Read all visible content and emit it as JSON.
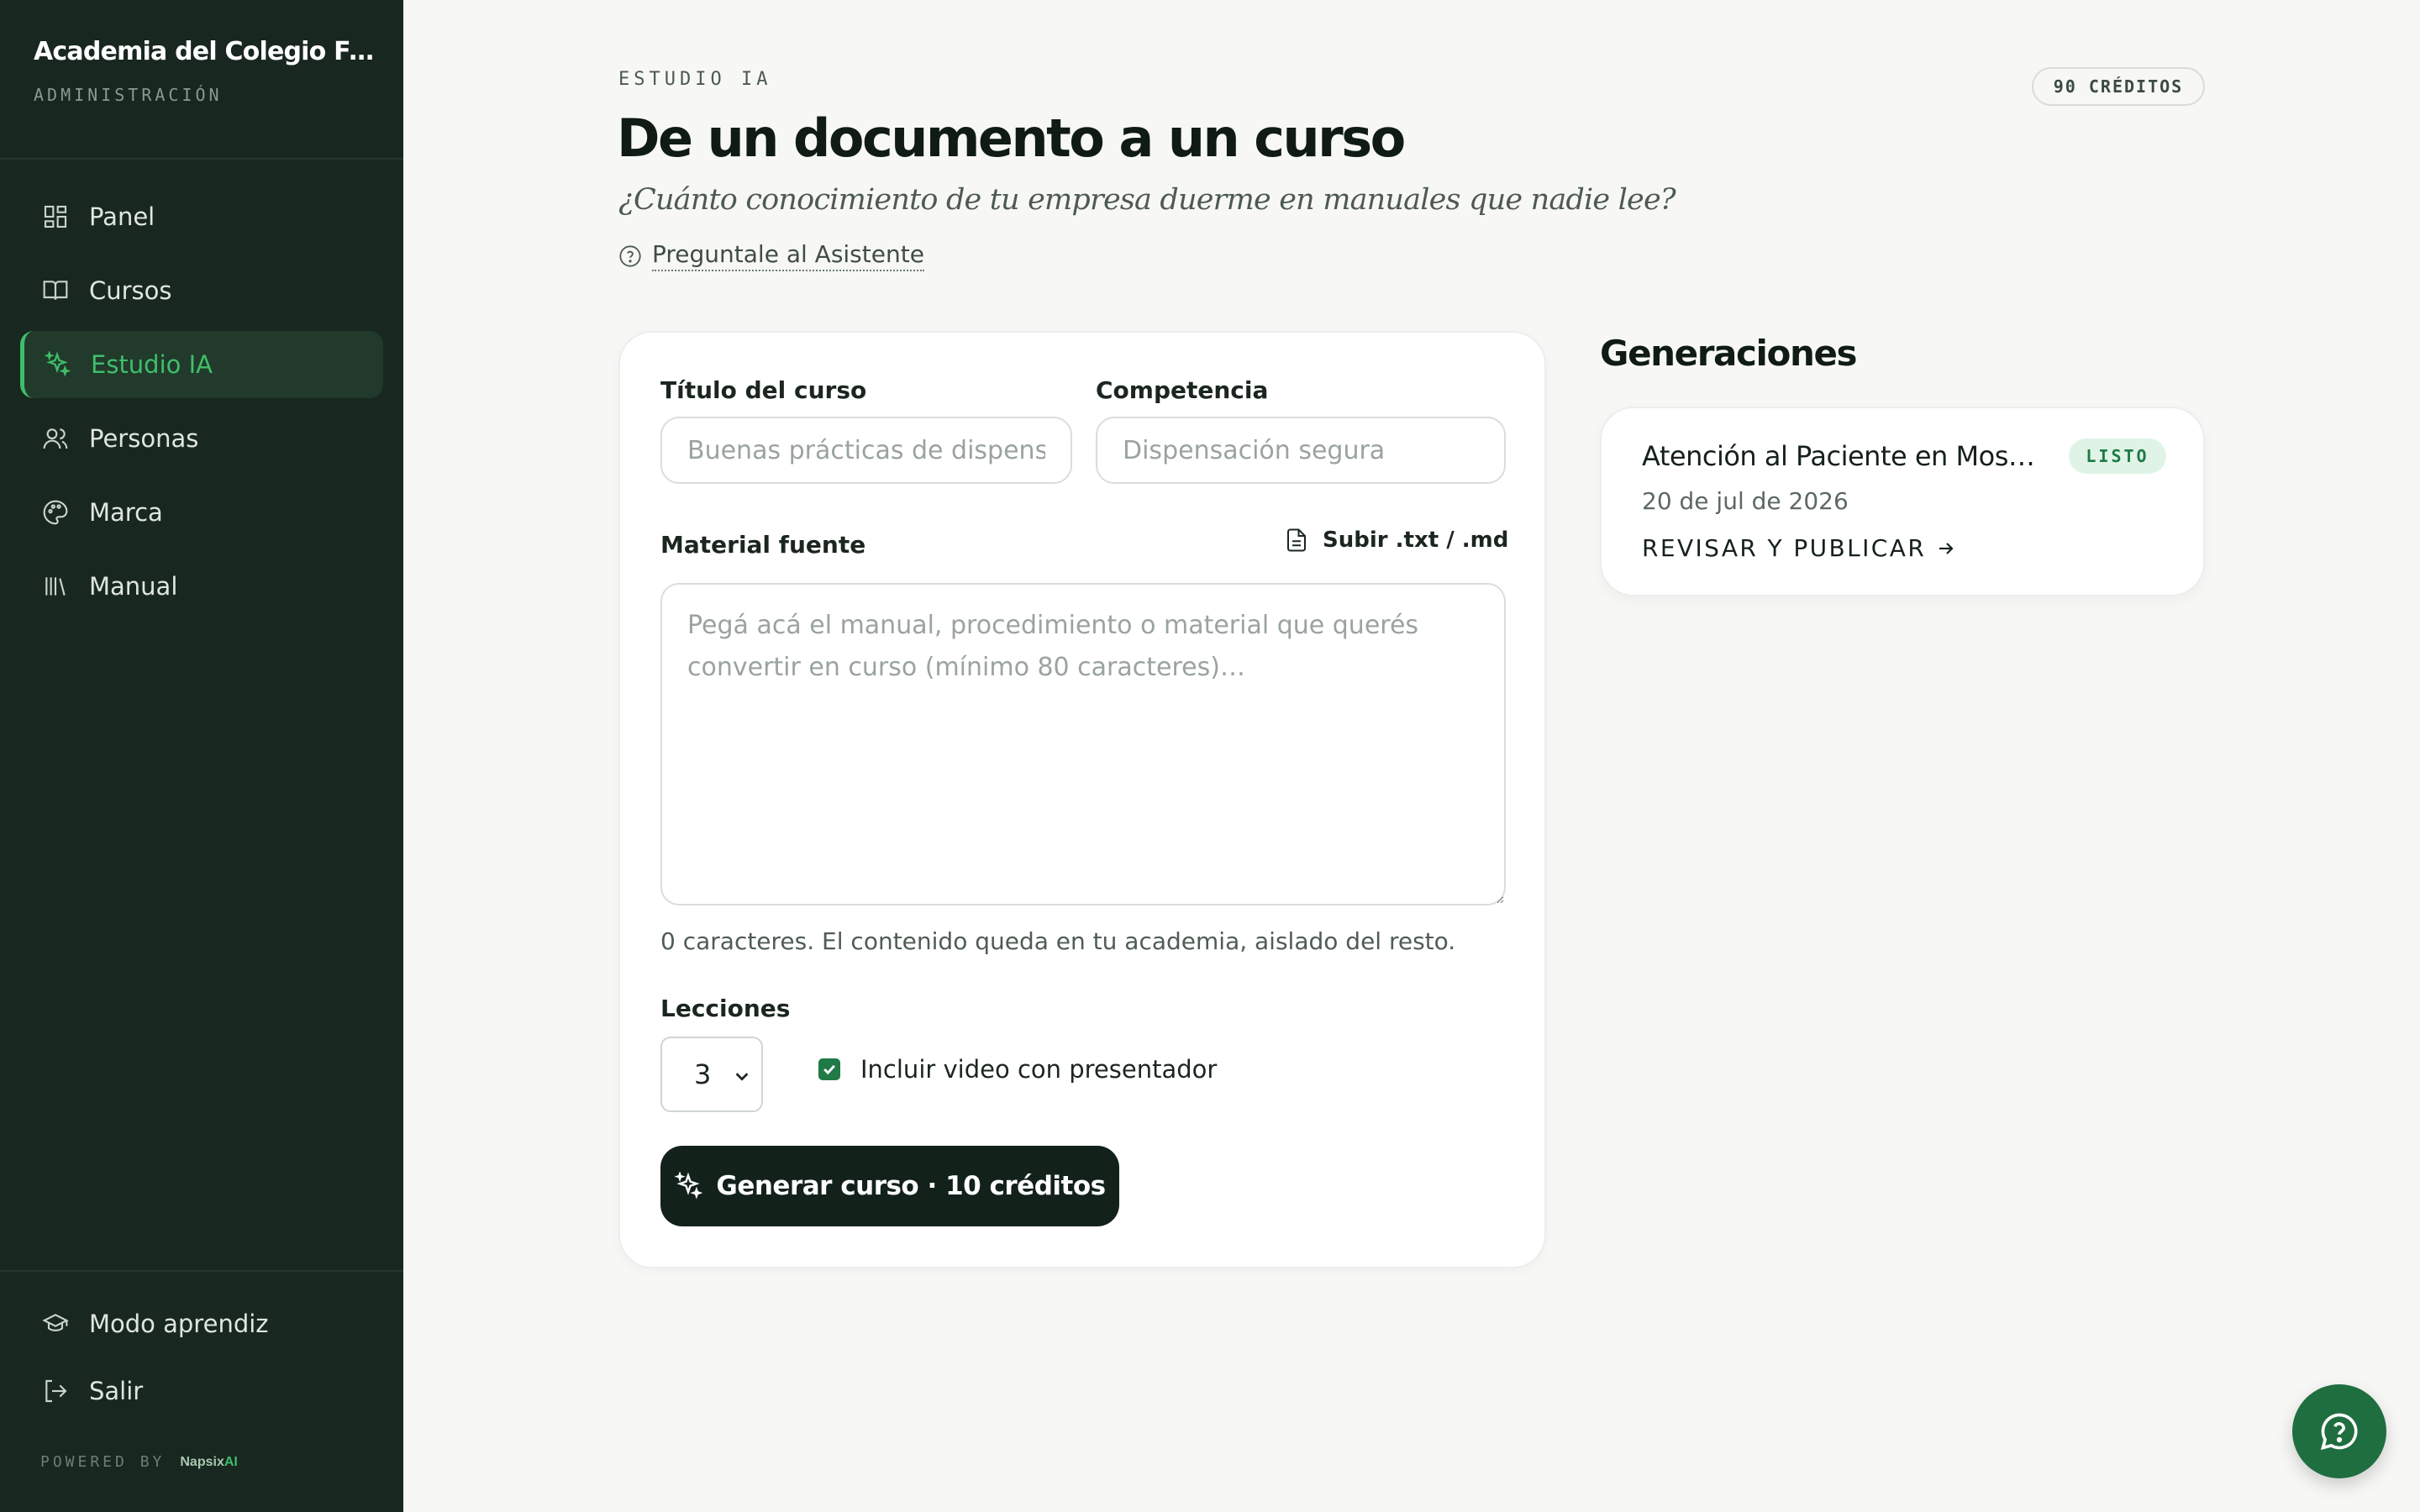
{
  "sidebar": {
    "brand_name": "Academia del Colegio Farmacéutico",
    "brand_sub": "ADMINISTRACIÓN",
    "items": [
      {
        "label": "Panel",
        "icon": "dashboard-icon"
      },
      {
        "label": "Cursos",
        "icon": "book-icon"
      },
      {
        "label": "Estudio IA",
        "icon": "sparkle-icon",
        "active": true
      },
      {
        "label": "Personas",
        "icon": "users-icon"
      },
      {
        "label": "Marca",
        "icon": "palette-icon"
      },
      {
        "label": "Manual",
        "icon": "library-icon"
      }
    ],
    "footer_items": [
      {
        "label": "Modo aprendiz",
        "icon": "graduation-cap-icon"
      },
      {
        "label": "Salir",
        "icon": "logout-icon"
      }
    ],
    "powered_by": "POWERED BY",
    "powered_logo_name": "Napsix",
    "powered_logo_suffix": "AI"
  },
  "header": {
    "eyebrow": "ESTUDIO IA",
    "credits": "90 CRÉDITOS",
    "title": "De un documento a un curso",
    "subtitle": "¿Cuánto conocimiento de tu empresa duerme en manuales que nadie lee?",
    "assistant_link": "Preguntale al Asistente"
  },
  "form": {
    "course_title_label": "Título del curso",
    "course_title_placeholder": "Buenas prácticas de dispensa",
    "competency_label": "Competencia",
    "competency_placeholder": "Dispensación segura",
    "source_label": "Material fuente",
    "upload_label": "Subir .txt / .md",
    "source_placeholder": "Pegá acá el manual, procedimiento o material que querés convertir en curso (mínimo 80 caracteres)…",
    "helper": "0 caracteres. El contenido queda en tu academia, aislado del resto.",
    "lessons_label": "Lecciones",
    "lessons_value": "3",
    "include_video_label": "Incluir video con presentador",
    "include_video_checked": true,
    "generate_label": "Generar curso · 10 créditos"
  },
  "generations": {
    "title": "Generaciones",
    "items": [
      {
        "name": "Atención al Paciente en Mostrador",
        "status": "LISTO",
        "date": "20 de jul de 2026",
        "action": "REVISAR Y PUBLICAR"
      }
    ]
  },
  "colors": {
    "sidebar_bg": "#18271f",
    "accent": "#3fbe6a",
    "primary_button": "#13211b",
    "success_badge_bg": "#dff4e6",
    "fab_bg": "#1f6e40"
  },
  "help_button_icon": "chat-help-icon"
}
